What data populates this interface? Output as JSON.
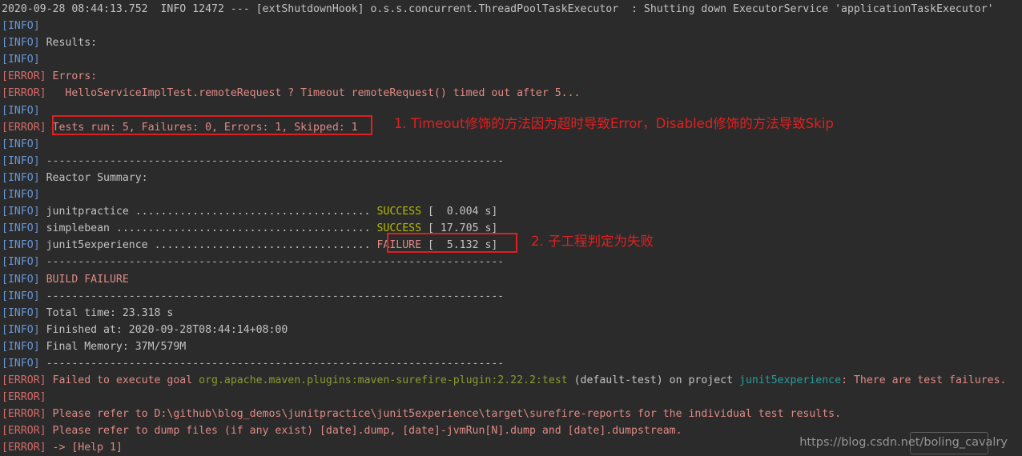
{
  "terminal": {
    "title": "maven-build-output-console",
    "background_color": "#2b2b2b",
    "colors": {
      "info": "#6897d8",
      "error": "#d66a6a",
      "plain": "#c3c3c3",
      "success": "#b5ba00",
      "failure": "#e08a84",
      "goal": "#8a9b2f",
      "project": "#2a9d9d",
      "annotation_red": "#e02020"
    },
    "lines": [
      {
        "id": "l1",
        "tag": "",
        "tag_class": "",
        "body": "2020-09-28 08:44:13.752  INFO 12472 --- [extShutdownHook] o.s.s.concurrent.ThreadPoolTaskExecutor  : Shutting down ExecutorService 'applicationTaskExecutor'",
        "body_class": "c-plain"
      },
      {
        "id": "l2",
        "tag": "[INFO]",
        "tag_class": "c-info",
        "body": "",
        "body_class": "c-plain"
      },
      {
        "id": "l3",
        "tag": "[INFO]",
        "tag_class": "c-info",
        "body": " Results:",
        "body_class": "c-plain"
      },
      {
        "id": "l4",
        "tag": "[INFO]",
        "tag_class": "c-info",
        "body": "",
        "body_class": "c-plain"
      },
      {
        "id": "l5",
        "tag": "[ERROR]",
        "tag_class": "c-error",
        "body": " Errors:",
        "body_class": "c-err-txt"
      },
      {
        "id": "l6",
        "tag": "[ERROR]",
        "tag_class": "c-error",
        "body": "   HelloServiceImplTest.remoteRequest ? Timeout remoteRequest() timed out after 5...",
        "body_class": "c-err-txt"
      },
      {
        "id": "l7",
        "tag": "[INFO]",
        "tag_class": "c-info",
        "body": "",
        "body_class": "c-plain"
      },
      {
        "id": "l8",
        "tag": "[ERROR]",
        "tag_class": "c-error",
        "body": " Tests run: 5, Failures: 0, Errors: 1, Skipped: 1",
        "body_class": "c-err-txt"
      },
      {
        "id": "l9",
        "tag": "[INFO]",
        "tag_class": "c-info",
        "body": "",
        "body_class": "c-plain"
      },
      {
        "id": "l10",
        "tag": "[INFO]",
        "tag_class": "c-info",
        "body": " ------------------------------------------------------------------------",
        "body_class": "c-dash"
      },
      {
        "id": "l11",
        "tag": "[INFO]",
        "tag_class": "c-info",
        "body": " Reactor Summary:",
        "body_class": "c-plain"
      },
      {
        "id": "l12",
        "tag": "[INFO]",
        "tag_class": "c-info",
        "body": "",
        "body_class": "c-plain"
      },
      {
        "id": "l13",
        "tag": "[INFO]",
        "tag_class": "c-info",
        "body": "",
        "body_class": "c-plain",
        "reactor": {
          "module": " junitpractice ",
          "dots": ".....................................",
          "status": "SUCCESS",
          "status_class": "c-success",
          "time": " [  0.004 s]"
        }
      },
      {
        "id": "l14",
        "tag": "[INFO]",
        "tag_class": "c-info",
        "body": "",
        "body_class": "c-plain",
        "reactor": {
          "module": " simplebean ",
          "dots": "........................................",
          "status": "SUCCESS",
          "status_class": "c-success",
          "time": " [ 17.705 s]"
        }
      },
      {
        "id": "l15",
        "tag": "[INFO]",
        "tag_class": "c-info",
        "body": "",
        "body_class": "c-plain",
        "reactor": {
          "module": " junit5experience ",
          "dots": "..................................",
          "status": "FAILURE",
          "status_class": "c-failure",
          "time": " [  5.132 s]"
        }
      },
      {
        "id": "l16",
        "tag": "[INFO]",
        "tag_class": "c-info",
        "body": " ------------------------------------------------------------------------",
        "body_class": "c-dash"
      },
      {
        "id": "l17",
        "tag": "[INFO]",
        "tag_class": "c-info",
        "body": " BUILD FAILURE",
        "body_class": "c-buildfail"
      },
      {
        "id": "l18",
        "tag": "[INFO]",
        "tag_class": "c-info",
        "body": " ------------------------------------------------------------------------",
        "body_class": "c-dash"
      },
      {
        "id": "l19",
        "tag": "[INFO]",
        "tag_class": "c-info",
        "body": " Total time: 23.318 s",
        "body_class": "c-plain"
      },
      {
        "id": "l20",
        "tag": "[INFO]",
        "tag_class": "c-info",
        "body": " Finished at: 2020-09-28T08:44:14+08:00",
        "body_class": "c-plain"
      },
      {
        "id": "l21",
        "tag": "[INFO]",
        "tag_class": "c-info",
        "body": " Final Memory: 37M/579M",
        "body_class": "c-plain"
      },
      {
        "id": "l22",
        "tag": "[INFO]",
        "tag_class": "c-info",
        "body": " ------------------------------------------------------------------------",
        "body_class": "c-dash"
      },
      {
        "id": "l23",
        "tag": "[ERROR]",
        "tag_class": "c-error",
        "body": "",
        "body_class": "c-plain",
        "goal_line": {
          "pre": " Failed to execute goal ",
          "goal": "org.apache.maven.plugins:maven-surefire-plugin:2.22.2:test",
          "mid": " (default-test) on project ",
          "project": "junit5experience",
          "post": ": There are test failures."
        }
      },
      {
        "id": "l24",
        "tag": "[ERROR]",
        "tag_class": "c-error",
        "body": "",
        "body_class": "c-plain"
      },
      {
        "id": "l25",
        "tag": "[ERROR]",
        "tag_class": "c-error",
        "body": " Please refer to D:\\github\\blog_demos\\junitpractice\\junit5experience\\target\\surefire-reports for the individual test results.",
        "body_class": "c-err-txt"
      },
      {
        "id": "l26",
        "tag": "[ERROR]",
        "tag_class": "c-error",
        "body": " Please refer to dump files (if any exist) [date].dump, [date]-jvmRun[N].dump and [date].dumpstream.",
        "body_class": "c-err-txt"
      },
      {
        "id": "l27",
        "tag": "[ERROR]",
        "tag_class": "c-error",
        "body": " -> [Help 1]",
        "body_class": "c-err-txt"
      }
    ]
  },
  "annotations": [
    {
      "id": "a1",
      "text": "1. Timeout修饰的方法因为超时导致Error，Disabled修饰的方法导致Skip"
    },
    {
      "id": "a2",
      "text": "2. 子工程判定为失败"
    }
  ],
  "watermark": {
    "text": "https://blog.csdn.net/boling_cavalry"
  }
}
